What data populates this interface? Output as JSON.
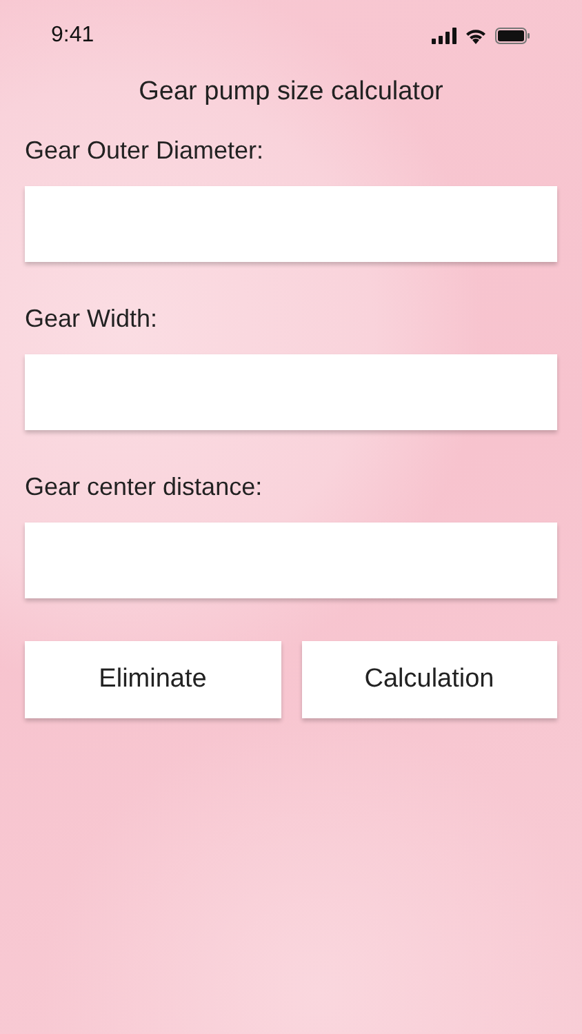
{
  "status_bar": {
    "time": "9:41"
  },
  "title": "Gear pump size calculator",
  "fields": [
    {
      "label": "Gear Outer Diameter:"
    },
    {
      "label": "Gear Width:"
    },
    {
      "label": "Gear center distance:"
    }
  ],
  "buttons": [
    "Eliminate",
    "Calculation"
  ]
}
